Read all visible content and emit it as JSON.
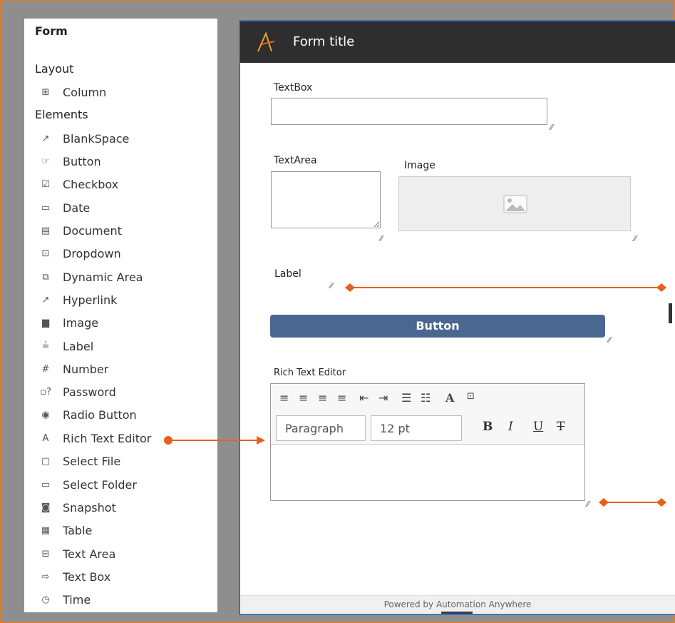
{
  "palette": {
    "title": "Form",
    "layout_heading": "Layout",
    "layout_items": [
      {
        "label": "Column",
        "icon": "column-icon"
      }
    ],
    "elements_heading": "Elements",
    "elements": [
      {
        "label": "BlankSpace",
        "icon": "blankspace-icon"
      },
      {
        "label": "Button",
        "icon": "button-icon"
      },
      {
        "label": "Checkbox",
        "icon": "checkbox-icon"
      },
      {
        "label": "Date",
        "icon": "calendar-icon"
      },
      {
        "label": "Document",
        "icon": "document-icon"
      },
      {
        "label": "Dropdown",
        "icon": "dropdown-icon"
      },
      {
        "label": "Dynamic Area",
        "icon": "dynamic-area-icon"
      },
      {
        "label": "Hyperlink",
        "icon": "hyperlink-icon"
      },
      {
        "label": "Image",
        "icon": "image-icon"
      },
      {
        "label": "Label",
        "icon": "label-icon"
      },
      {
        "label": "Number",
        "icon": "hash-icon"
      },
      {
        "label": "Password",
        "icon": "password-icon"
      },
      {
        "label": "Radio Button",
        "icon": "radio-icon"
      },
      {
        "label": "Rich Text Editor",
        "icon": "rich-text-icon"
      },
      {
        "label": "Select File",
        "icon": "file-icon"
      },
      {
        "label": "Select Folder",
        "icon": "folder-icon"
      },
      {
        "label": "Snapshot",
        "icon": "camera-icon"
      },
      {
        "label": "Table",
        "icon": "table-icon"
      },
      {
        "label": "Text Area",
        "icon": "text-area-icon"
      },
      {
        "label": "Text Box",
        "icon": "text-box-icon"
      },
      {
        "label": "Time",
        "icon": "clock-icon"
      }
    ]
  },
  "form": {
    "title": "Form title",
    "textbox_label": "TextBox",
    "textarea_label": "TextArea",
    "image_label": "Image",
    "label_text": "Label",
    "button_label": "Button",
    "rte_label": "Rich Text Editor",
    "rte_paragraph": "Paragraph",
    "rte_font_size": "12 pt",
    "rte_bold": "B",
    "rte_italic": "I",
    "rte_underline": "U",
    "rte_strike": "T",
    "footer": "Powered by Automation Anywhere"
  },
  "colors": {
    "accent": "#e8601c",
    "header_bg": "#2e2e2e",
    "button_bg": "#4a6790"
  }
}
